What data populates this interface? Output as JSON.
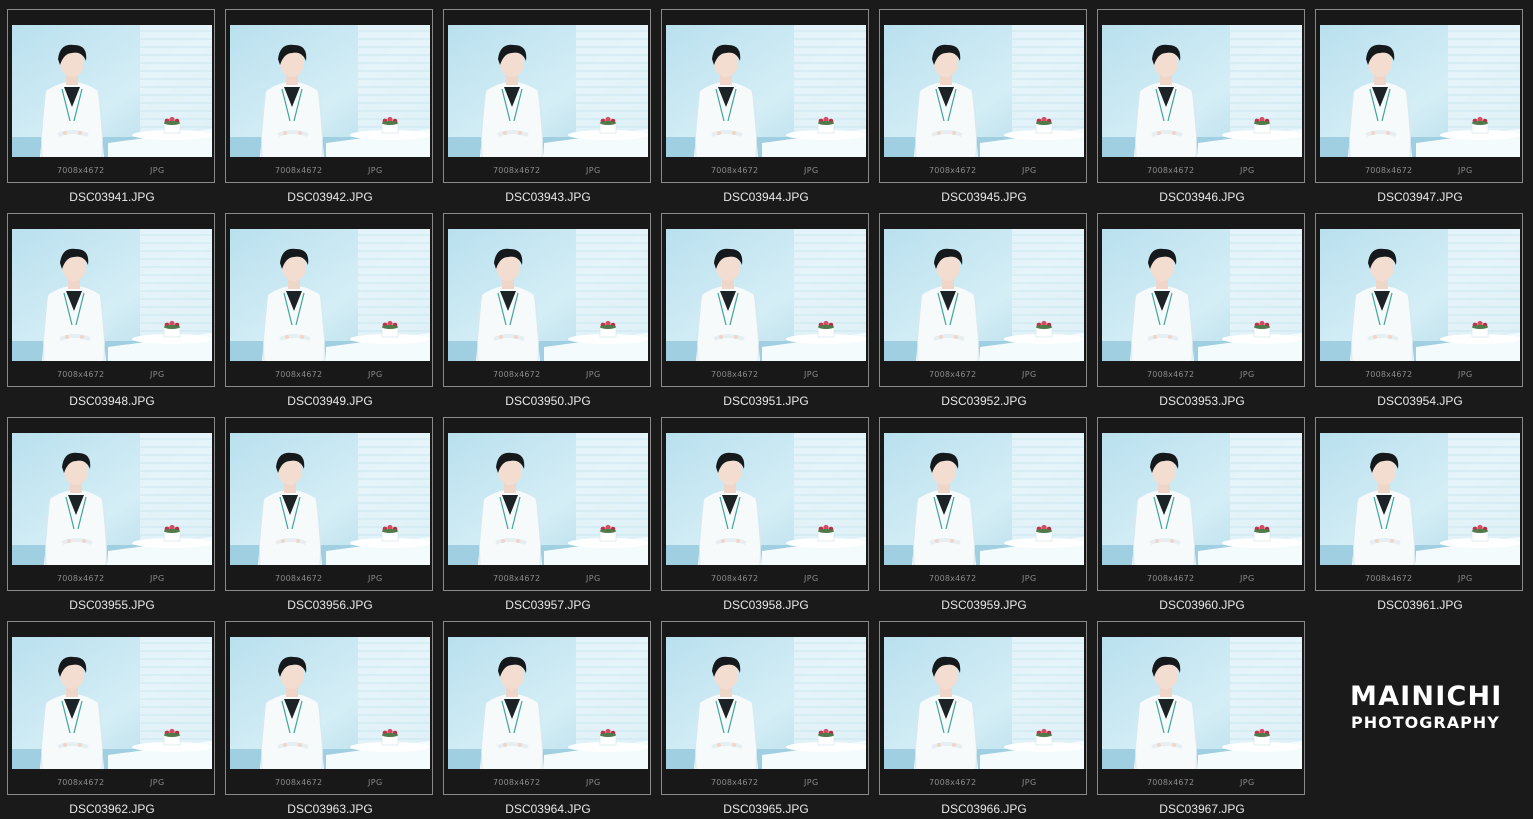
{
  "thumbnails": [
    {
      "filename": "DSC03941.JPG",
      "dimensions": "7008x4672",
      "type": "JPG"
    },
    {
      "filename": "DSC03942.JPG",
      "dimensions": "7008x4672",
      "type": "JPG"
    },
    {
      "filename": "DSC03943.JPG",
      "dimensions": "7008x4672",
      "type": "JPG"
    },
    {
      "filename": "DSC03944.JPG",
      "dimensions": "7008x4672",
      "type": "JPG"
    },
    {
      "filename": "DSC03945.JPG",
      "dimensions": "7008x4672",
      "type": "JPG"
    },
    {
      "filename": "DSC03946.JPG",
      "dimensions": "7008x4672",
      "type": "JPG"
    },
    {
      "filename": "DSC03947.JPG",
      "dimensions": "7008x4672",
      "type": "JPG"
    },
    {
      "filename": "DSC03948.JPG",
      "dimensions": "7008x4672",
      "type": "JPG"
    },
    {
      "filename": "DSC03949.JPG",
      "dimensions": "7008x4672",
      "type": "JPG"
    },
    {
      "filename": "DSC03950.JPG",
      "dimensions": "7008x4672",
      "type": "JPG"
    },
    {
      "filename": "DSC03951.JPG",
      "dimensions": "7008x4672",
      "type": "JPG"
    },
    {
      "filename": "DSC03952.JPG",
      "dimensions": "7008x4672",
      "type": "JPG"
    },
    {
      "filename": "DSC03953.JPG",
      "dimensions": "7008x4672",
      "type": "JPG"
    },
    {
      "filename": "DSC03954.JPG",
      "dimensions": "7008x4672",
      "type": "JPG"
    },
    {
      "filename": "DSC03955.JPG",
      "dimensions": "7008x4672",
      "type": "JPG"
    },
    {
      "filename": "DSC03956.JPG",
      "dimensions": "7008x4672",
      "type": "JPG"
    },
    {
      "filename": "DSC03957.JPG",
      "dimensions": "7008x4672",
      "type": "JPG"
    },
    {
      "filename": "DSC03958.JPG",
      "dimensions": "7008x4672",
      "type": "JPG"
    },
    {
      "filename": "DSC03959.JPG",
      "dimensions": "7008x4672",
      "type": "JPG"
    },
    {
      "filename": "DSC03960.JPG",
      "dimensions": "7008x4672",
      "type": "JPG"
    },
    {
      "filename": "DSC03961.JPG",
      "dimensions": "7008x4672",
      "type": "JPG"
    },
    {
      "filename": "DSC03962.JPG",
      "dimensions": "7008x4672",
      "type": "JPG"
    },
    {
      "filename": "DSC03963.JPG",
      "dimensions": "7008x4672",
      "type": "JPG"
    },
    {
      "filename": "DSC03964.JPG",
      "dimensions": "7008x4672",
      "type": "JPG"
    },
    {
      "filename": "DSC03965.JPG",
      "dimensions": "7008x4672",
      "type": "JPG"
    },
    {
      "filename": "DSC03966.JPG",
      "dimensions": "7008x4672",
      "type": "JPG"
    },
    {
      "filename": "DSC03967.JPG",
      "dimensions": "7008x4672",
      "type": "JPG"
    }
  ],
  "watermark": {
    "line1": "MAINICHI",
    "line2": "PHOTOGRAPHY"
  },
  "colors": {
    "background": "#1a1a1a",
    "frame_border": "#8a8a8a",
    "filename_text": "#e8e8e8",
    "meta_text": "#8a8a8a",
    "photo_sky": "#c9e8f2",
    "photo_wall": "#e4f4f8"
  }
}
